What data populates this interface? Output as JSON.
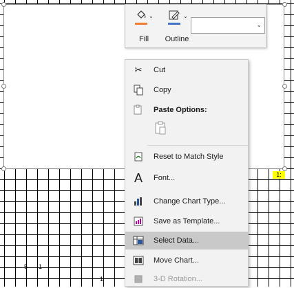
{
  "sheet": {
    "cells": [
      {
        "text": "5"
      },
      {
        "text": "1"
      },
      {
        "text": "1"
      }
    ],
    "highlight_cell": {
      "text": "1:",
      "color": "#ffff00"
    }
  },
  "mini_toolbar": {
    "fill_label": "Fill",
    "outline_label": "Outline",
    "fill_color": "#ed7d31",
    "outline_color": "#4472c4",
    "element_select_value": ""
  },
  "context_menu": {
    "items": [
      {
        "label": "Cut",
        "icon": "scissors-icon"
      },
      {
        "label": "Copy",
        "icon": "copy-icon"
      },
      {
        "label": "Paste Options:",
        "icon": "paste-icon"
      },
      {
        "label": "Reset to Match Style",
        "icon": "reset-style-icon"
      },
      {
        "label": "Font...",
        "icon": "font-icon"
      },
      {
        "label": "Change Chart Type...",
        "icon": "chart-type-icon"
      },
      {
        "label": "Save as Template...",
        "icon": "template-icon"
      },
      {
        "label": "Select Data...",
        "icon": "select-data-icon",
        "highlighted": true
      },
      {
        "label": "Move Chart...",
        "icon": "move-chart-icon"
      },
      {
        "label": "3-D Rotation...",
        "icon": "rotation-icon",
        "disabled": true
      }
    ]
  }
}
